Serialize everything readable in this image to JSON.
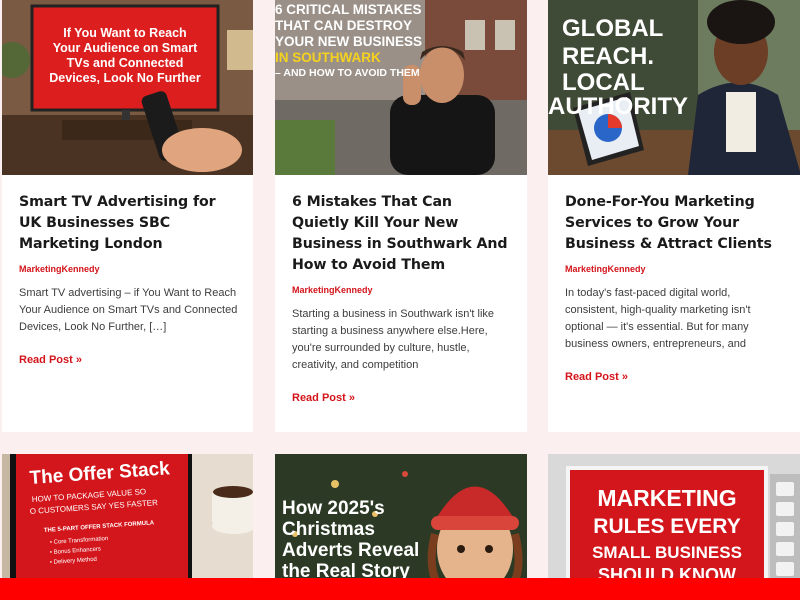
{
  "colors": {
    "accent": "#d3141a",
    "page_background": "#fbeff0",
    "bottom_bar": "#ff0000"
  },
  "posts": [
    {
      "title": "Smart TV Advertising for UK Businesses SBC Marketing London",
      "author": "MarketingKennedy",
      "excerpt": "Smart TV advertising – if You Want to Reach Your Audience on Smart TVs and Connected Devices, Look No Further, […]",
      "read_more": "Read Post »",
      "image_text": [
        "If You Want to Reach",
        "Your Audience on Smart",
        "TVs and Connected",
        "Devices, Look No Further"
      ]
    },
    {
      "title": "6 Mistakes That Can Quietly Kill Your New Business in Southwark And How to Avoid Them",
      "author": "MarketingKennedy",
      "excerpt": "Starting a business in Southwark isn't like starting a business anywhere else.Here, you're surrounded by culture, hustle, creativity, and competition",
      "read_more": "Read Post »",
      "image_text": [
        "6 CRITICAL MISTAKES",
        "THAT CAN DESTROY",
        "YOUR NEW BUSINESS",
        "IN SOUTHWARK",
        "– AND HOW TO AVOID THEM"
      ]
    },
    {
      "title": "Done-For-You Marketing Services to Grow Your Business & Attract Clients",
      "author": "MarketingKennedy",
      "excerpt": "In today's fast-paced digital world, consistent, high-quality marketing isn't optional — it's essential. But for many business owners, entrepreneurs, and",
      "read_more": "Read Post »",
      "image_text": [
        "GLOBAL",
        "REACH.",
        "LOCAL",
        "AUTHORITY"
      ]
    },
    {
      "image_text": [
        "The Offer Stack",
        "HOW TO PACKAGE VALUE SO",
        "O CUSTOMERS SAY YES FASTER",
        "THE 5-PART OFFER STACK FORMULA",
        "• Core Transformation",
        "• Bonus Enhancers",
        "• Delivery Method"
      ]
    },
    {
      "image_text": [
        "How 2025's",
        "Christmas",
        "Adverts Reveal",
        "the Real Story"
      ]
    },
    {
      "image_text": [
        "MARKETING",
        "RULES EVERY",
        "SMALL BUSINESS",
        "SHOULD KNOW"
      ]
    }
  ]
}
